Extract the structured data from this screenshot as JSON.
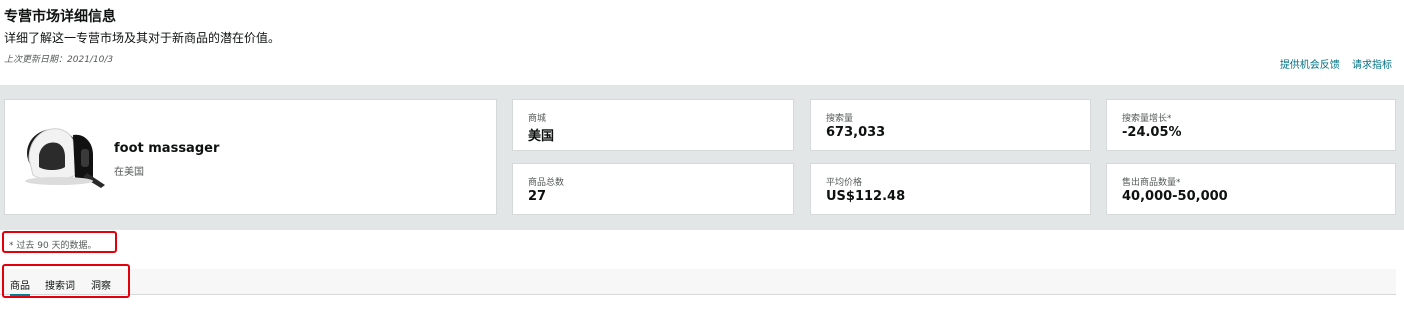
{
  "header": {
    "title": "专营市场详细信息",
    "subtitle": "详细了解这一专营市场及其对于新商品的潜在价值。",
    "last_updated_label": "上次更新日期：",
    "last_updated_value": "2021/10/3"
  },
  "links": {
    "feedback": "提供机会反馈",
    "request_metrics": "请求指标"
  },
  "product": {
    "name": "foot massager",
    "location": "在美国",
    "image_icon": "foot-massager-image"
  },
  "metrics": [
    {
      "label": "商城",
      "value": "美国"
    },
    {
      "label": "搜索量",
      "value": "673,033"
    },
    {
      "label": "搜索量增长*",
      "value": "-24.05%"
    },
    {
      "label": "商品总数",
      "value": "27"
    },
    {
      "label": "平均价格",
      "value": "US$112.48"
    },
    {
      "label": "售出商品数量*",
      "value": "40,000-50,000"
    }
  ],
  "footnote": "* 过去 90 天的数据。",
  "tabs": [
    {
      "label": "商品",
      "active": true
    },
    {
      "label": "搜索词",
      "active": false
    },
    {
      "label": "洞察",
      "active": false
    }
  ],
  "colors": {
    "link": "#007185",
    "tab_underline": "#008296",
    "highlight_box": "#e3000b",
    "band_bg": "#e3e6e6"
  }
}
